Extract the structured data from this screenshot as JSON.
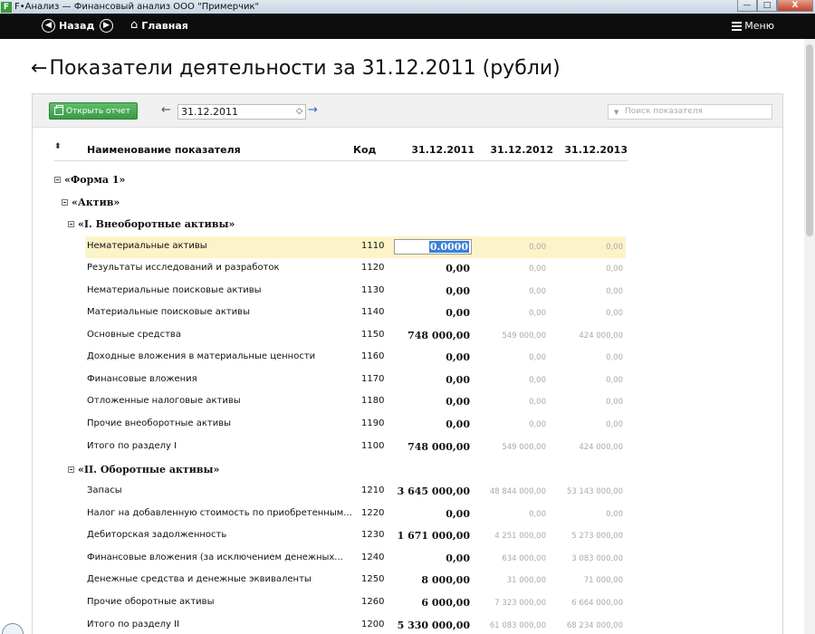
{
  "window": {
    "app_badge": "F",
    "title": "F•Анализ — Финансовый анализ ООО \"Примерчик\"",
    "controls": [
      "—",
      "□",
      "X"
    ]
  },
  "navbar": {
    "back_label": "Назад",
    "home_label": "Главная",
    "menu_label": "Меню"
  },
  "page": {
    "title": "Показатели деятельности за 31.12.2011 (рубли)"
  },
  "toolbar": {
    "open_report_label": "Открыть отчет",
    "selected_date": "31.12.2011",
    "search_placeholder": "Поиск показателя"
  },
  "table": {
    "headers": {
      "name": "Наименование показателя",
      "code": "Код",
      "d1": "31.12.2011",
      "d2": "31.12.2012",
      "d3": "31.12.2013"
    },
    "groups": {
      "form1": "«Форма 1»",
      "assets": "«Актив»",
      "section1": "«I. Внеоборотные активы»",
      "section2": "«II. Оборотные активы»"
    },
    "editing_value": "0.0000",
    "rows": [
      {
        "name": "Нематериальные активы",
        "code": "1110",
        "v1": "",
        "v2": "0,00",
        "v3": "0,00"
      },
      {
        "name": "Результаты исследований и разработок",
        "code": "1120",
        "v1": "0,00",
        "v2": "0,00",
        "v3": "0,00"
      },
      {
        "name": "Нематериальные поисковые активы",
        "code": "1130",
        "v1": "0,00",
        "v2": "0,00",
        "v3": "0,00"
      },
      {
        "name": "Материальные поисковые активы",
        "code": "1140",
        "v1": "0,00",
        "v2": "0,00",
        "v3": "0,00"
      },
      {
        "name": "Основные средства",
        "code": "1150",
        "v1": "748 000,00",
        "v2": "549 000,00",
        "v3": "424 000,00"
      },
      {
        "name": "Доходные вложения в материальные ценности",
        "code": "1160",
        "v1": "0,00",
        "v2": "0,00",
        "v3": "0,00"
      },
      {
        "name": "Финансовые вложения",
        "code": "1170",
        "v1": "0,00",
        "v2": "0,00",
        "v3": "0,00"
      },
      {
        "name": "Отложенные налоговые активы",
        "code": "1180",
        "v1": "0,00",
        "v2": "0,00",
        "v3": "0,00"
      },
      {
        "name": "Прочие внеоборотные активы",
        "code": "1190",
        "v1": "0,00",
        "v2": "0,00",
        "v3": "0,00"
      },
      {
        "name": "Итого по разделу I",
        "code": "1100",
        "v1": "748 000,00",
        "v2": "549 000,00",
        "v3": "424 000,00"
      },
      {
        "name": "Запасы",
        "code": "1210",
        "v1": "3 645 000,00",
        "v2": "48 844 000,00",
        "v3": "53 143 000,00"
      },
      {
        "name": "Налог на добавленную стоимость по приобретенным...",
        "code": "1220",
        "v1": "0,00",
        "v2": "0,00",
        "v3": "0,00"
      },
      {
        "name": "Дебиторская задолженность",
        "code": "1230",
        "v1": "1 671 000,00",
        "v2": "4 251 000,00",
        "v3": "5 273 000,00"
      },
      {
        "name": "Финансовые вложения (за исключением денежных...",
        "code": "1240",
        "v1": "0,00",
        "v2": "634 000,00",
        "v3": "3 083 000,00"
      },
      {
        "name": "Денежные средства и денежные эквиваленты",
        "code": "1250",
        "v1": "8 000,00",
        "v2": "31 000,00",
        "v3": "71 000,00"
      },
      {
        "name": "Прочие оборотные активы",
        "code": "1260",
        "v1": "6 000,00",
        "v2": "7 323 000,00",
        "v3": "6 664 000,00"
      },
      {
        "name": "Итого по разделу II",
        "code": "1200",
        "v1": "5 330 000,00",
        "v2": "61 083 000,00",
        "v3": "68 234 000,00"
      }
    ]
  }
}
